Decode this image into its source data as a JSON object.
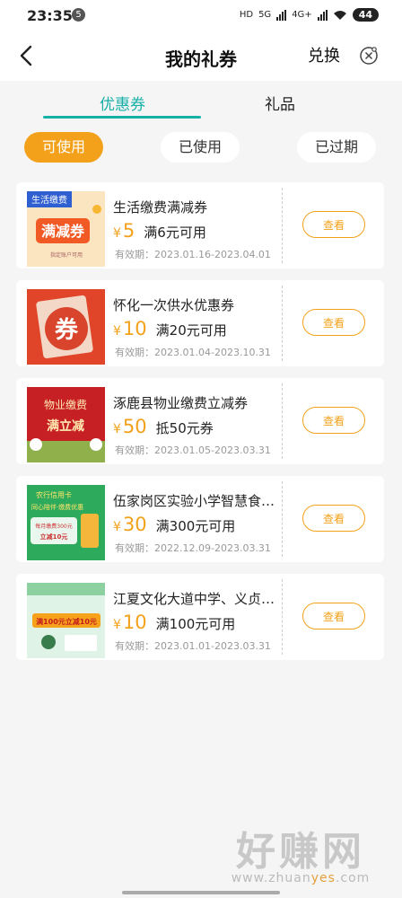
{
  "status_bar": {
    "time": "23:35",
    "notif_badge": "5",
    "hd_label": "HD",
    "net1": "5G",
    "net2": "4G+",
    "battery": "44"
  },
  "header": {
    "title": "我的礼券",
    "action": "兑换"
  },
  "tabs": [
    {
      "label": "优惠券",
      "active": true
    },
    {
      "label": "礼品",
      "active": false
    }
  ],
  "filters": [
    {
      "label": "可使用",
      "active": true
    },
    {
      "label": "已使用",
      "active": false
    },
    {
      "label": "已过期",
      "active": false
    }
  ],
  "coupons": [
    {
      "name": "生活缴费满减券",
      "currency": "¥",
      "amount": "5",
      "condition": "满6元可用",
      "validity": "有效期：2023.01.16-2023.04.01",
      "button": "查看",
      "thumb_text": {
        "tag": "生活缴费",
        "main": "满减券",
        "sub": "指定账户可用"
      }
    },
    {
      "name": "怀化一次供水优惠券",
      "currency": "¥",
      "amount": "10",
      "condition": "满20元可用",
      "validity": "有效期：2023.01.04-2023.10.31",
      "button": "查看",
      "thumb_text": {
        "main": "券"
      }
    },
    {
      "name": "涿鹿县物业缴费立减券",
      "currency": "¥",
      "amount": "50",
      "condition": "抵50元券",
      "validity": "有效期：2023.01.05-2023.03.31",
      "button": "查看",
      "thumb_text": {
        "top": "物业缴费",
        "main": "满立减"
      }
    },
    {
      "name": "伍家岗区实验小学智慧食…",
      "currency": "¥",
      "amount": "30",
      "condition": "满300元可用",
      "validity": "有效期：2022.12.09-2023.03.31",
      "button": "查看",
      "thumb_text": {
        "top": "农行信用卡",
        "mid": "同心陪伴·缴费优惠",
        "main": "每月缴费300元",
        "sub": "立减10元"
      }
    },
    {
      "name": "江夏文化大道中学、义贞…",
      "currency": "¥",
      "amount": "10",
      "condition": "满100元可用",
      "validity": "有效期：2023.01.01-2023.03.31",
      "button": "查看",
      "thumb_text": {
        "main": "满100元立减10元"
      }
    }
  ],
  "watermark": {
    "big": "好赚网",
    "small_a": "www.zhuan",
    "small_b": "yes",
    "small_c": ".com"
  },
  "colors": {
    "accent_teal": "#16b0a7",
    "accent_orange": "#f3a11a"
  }
}
